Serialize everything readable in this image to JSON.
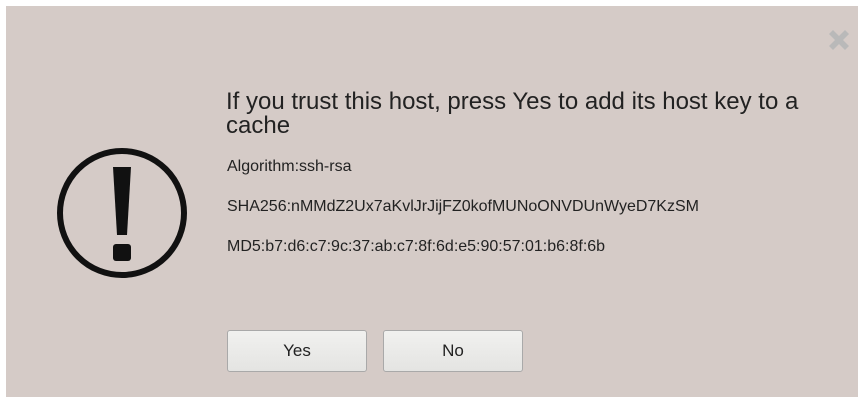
{
  "dialog": {
    "title": "If you trust this host, press Yes to add its host key to a cache",
    "algorithm": "Algorithm:ssh-rsa",
    "sha256": "SHA256:nMMdZ2Ux7aKvlJrJijFZ0kofMUNoONVDUnWyeD7KzSM",
    "md5": "MD5:b7:d6:c7:9c:37:ab:c7:8f:6d:e5:90:57:01:b6:8f:6b",
    "yes_label": "Yes",
    "no_label": "No"
  },
  "icons": {
    "close": "close-icon",
    "warning": "exclamation-circle-icon"
  },
  "colors": {
    "dialog_background": "#d5cbc7",
    "close_icon": "#b9b9b9",
    "warning_icon": "#111111"
  }
}
